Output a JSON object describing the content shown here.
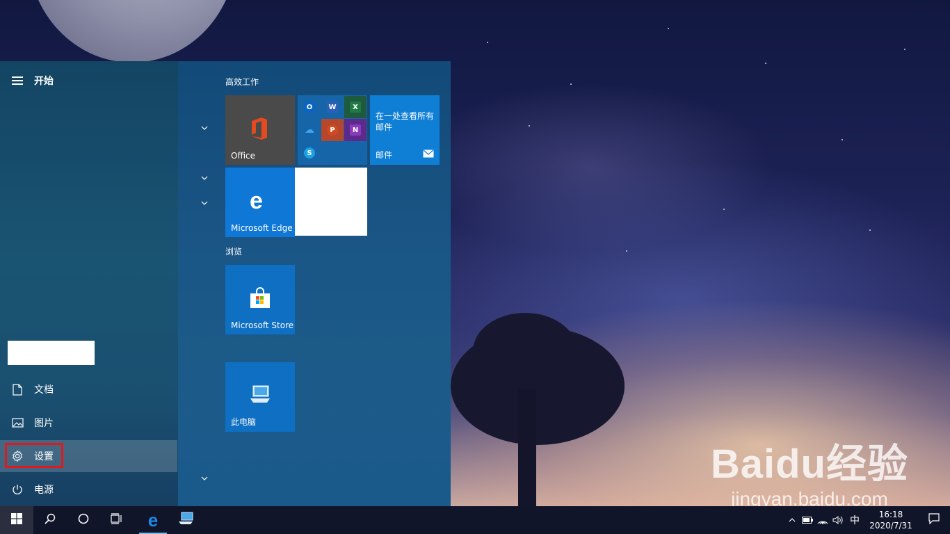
{
  "start_menu": {
    "title": "开始",
    "rail_items": [
      {
        "label": "文档",
        "icon": "document-icon"
      },
      {
        "label": "图片",
        "icon": "pictures-icon"
      },
      {
        "label": "设置",
        "icon": "gear-icon"
      },
      {
        "label": "电源",
        "icon": "power-icon"
      }
    ],
    "groups": [
      {
        "title": "高效工作"
      },
      {
        "title": "浏览"
      }
    ],
    "tiles": {
      "office": "Office",
      "mail_desc": "在一处查看所有邮件",
      "mail": "邮件",
      "edge": "Microsoft Edge",
      "store": "Microsoft Store",
      "pc": "此电脑"
    },
    "mini_apps": [
      "outlook-icon",
      "word-icon",
      "excel-icon",
      "onedrive-icon",
      "powerpoint-icon",
      "onenote-icon",
      "skype-icon"
    ]
  },
  "taskbar": {
    "ime": "中",
    "time": "16:18",
    "date": "2020/7/31"
  },
  "watermark": {
    "title": "Baidu经验",
    "url": "jingyan.baidu.com"
  },
  "colors": {
    "accent": "#0f78d7",
    "highlight": "#e3181d"
  }
}
